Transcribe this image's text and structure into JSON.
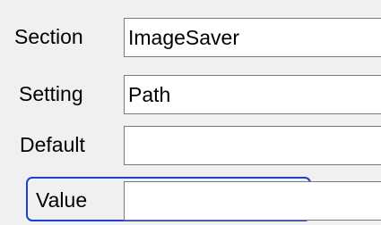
{
  "form": {
    "rows": [
      {
        "label": "Section",
        "value": "ImageSaver"
      },
      {
        "label": "Setting",
        "value": "Path"
      },
      {
        "label": "Default",
        "value": ""
      },
      {
        "label": "Value",
        "value": ""
      }
    ]
  },
  "colors": {
    "background": "#f0f0f0",
    "field_border": "#7a7a7a",
    "highlight_border": "#1f3fd8"
  }
}
